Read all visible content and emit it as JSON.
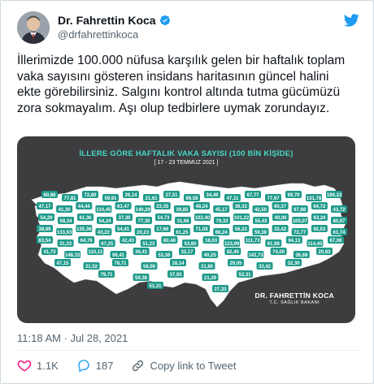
{
  "author": {
    "display_name": "Dr. Fahrettin Koca",
    "handle": "@drfahrettinkoca"
  },
  "tweet": {
    "text": "İllerimizde 100.000 nüfusa karşılık gelen bir haftalık toplam vaka sayısını gösteren insidans haritasının güncel halini ekte görebilirsiniz. Salgını kontrol altında tutma gücümüzü zora sokmayalım. Aşı olup tedbirlere uymak zorundayız.",
    "timestamp": "11:18 AM · Jul 28, 2021"
  },
  "media": {
    "title": "İLLERE GÖRE HAFTALIK VAKA SAYISI (100 BİN KİŞİDE)",
    "date_range": "[ 17 - 23 TEMMUZ 2021 ]",
    "signature_name": "DR. FAHRETTİN KOCA",
    "signature_title": "T.C. SAĞLIK BAKANI",
    "province_values": [
      "60,86",
      "77,81",
      "72,80",
      "59,91",
      "26,14",
      "21,61",
      "27,51",
      "86,58",
      "34,49",
      "47,11",
      "67,77",
      "77,67",
      "99,70",
      "131,78",
      "189,33",
      "47,17",
      "41,30",
      "44,44",
      "110,45",
      "63,47",
      "140,29",
      "23,35",
      "39,85",
      "48,24",
      "45,17",
      "36,33",
      "42,50",
      "60,37",
      "67,88",
      "64,72",
      "43,72",
      "54,29",
      "58,34",
      "61,36",
      "54,24",
      "37,30",
      "77,30",
      "54,73",
      "31,66",
      "102,40",
      "79,33",
      "101,22",
      "55,43",
      "40,00",
      "105,07",
      "63,24",
      "80,07",
      "38,69",
      "133,93",
      "135,36",
      "43,22",
      "54,41",
      "20,23",
      "17,66",
      "61,25",
      "71,08",
      "66,24",
      "56,33",
      "59,38",
      "33,42",
      "72,77",
      "92,53",
      "61,74",
      "83,54",
      "31,33",
      "64,76",
      "67,25",
      "42,43",
      "51,23",
      "80,48",
      "53,60",
      "18,03",
      "123,99",
      "111,73",
      "91,98",
      "94,13",
      "114,45",
      "67,06",
      "41,73",
      "148,33",
      "110,11",
      "96,41",
      "36,41",
      "53,36",
      "32,17",
      "40,25",
      "82,40",
      "142,73",
      "74,00",
      "36,69",
      "20,63",
      "47,15",
      "21,52",
      "78,71",
      "58,00",
      "28,14",
      "31,80",
      "29,05",
      "33,42",
      "32,30",
      "79,71",
      "59,38",
      "37,93",
      "21,29",
      "53,31",
      "51,31",
      "27,33"
    ],
    "region_colors": {
      "ocean": "#3d3c3e",
      "land": "#ffffff",
      "badge": "#1e9a8a",
      "accent": "#46d9c8"
    }
  },
  "actions": {
    "like_count": "1.1K",
    "reply_count": "187",
    "copy_link_label": "Copy link to Tweet"
  },
  "colors": {
    "brand": "#1d9bf0",
    "text": "#0f1419",
    "secondary": "#536471",
    "like": "#f91880"
  }
}
